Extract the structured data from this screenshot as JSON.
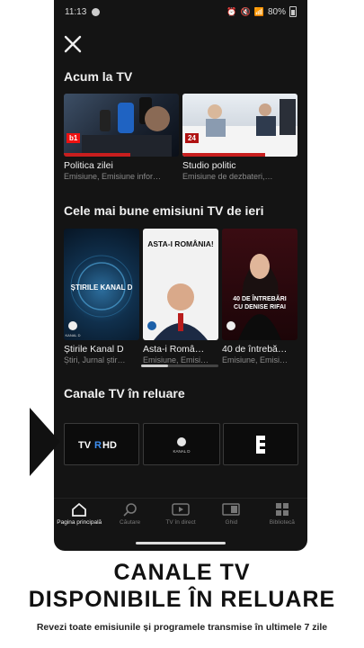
{
  "status_bar": {
    "time": "11:13",
    "battery": "80%"
  },
  "sections": {
    "live": {
      "title": "Acum la TV",
      "items": [
        {
          "title": "Politica zilei",
          "subtitle": "Emisiune, Emisiune infor…",
          "badge": "b1"
        },
        {
          "title": "Studio politic",
          "subtitle": "Emisiune de dezbateri,…",
          "badge": "24"
        }
      ]
    },
    "best": {
      "title": "Cele mai bune emisiuni TV de ieri",
      "items": [
        {
          "title": "Știrile Kanal D",
          "subtitle": "Știri, Jurnal știr…",
          "poster_text": "ȘTIRILE KANAL D",
          "logo": "KANAL D"
        },
        {
          "title": "Asta-i Româ…",
          "subtitle": "Emisiune, Emisi…",
          "poster_text": "ASTA-I ROMÂNIA!",
          "logo": "KANAL D"
        },
        {
          "title": "40 de întrebă…",
          "subtitle": "Emisiune, Emisi…",
          "poster_text": "40 DE ÎNTREBĂRI CU DENISE RIFAI",
          "logo": "KANAL D"
        }
      ]
    },
    "replay": {
      "title": "Canale TV în reluare",
      "channels": [
        {
          "name": "TVR HD",
          "icon": "tvr-hd-logo"
        },
        {
          "name": "KANAL D",
          "icon": "kanal-d-logo"
        },
        {
          "name": "E",
          "icon": "e-logo"
        }
      ]
    }
  },
  "nav": [
    {
      "label": "Pagina principală",
      "icon": "home-icon",
      "active": true
    },
    {
      "label": "Căutare",
      "icon": "search-icon",
      "active": false
    },
    {
      "label": "TV în direct",
      "icon": "live-tv-icon",
      "active": false
    },
    {
      "label": "Ghid",
      "icon": "guide-icon",
      "active": false
    },
    {
      "label": "Bibliotecă",
      "icon": "library-icon",
      "active": false
    }
  ],
  "promo": {
    "headline_line1": "CANALE TV",
    "headline_line2": "DISPONIBILE ÎN RELUARE",
    "tagline": "Revezi toate emisiunile și programele transmise în ultimele 7 zile"
  },
  "colors": {
    "background": "#141414",
    "accent": "#c81e1e",
    "text": "#f0f0f0",
    "muted": "#8a8a8a"
  }
}
